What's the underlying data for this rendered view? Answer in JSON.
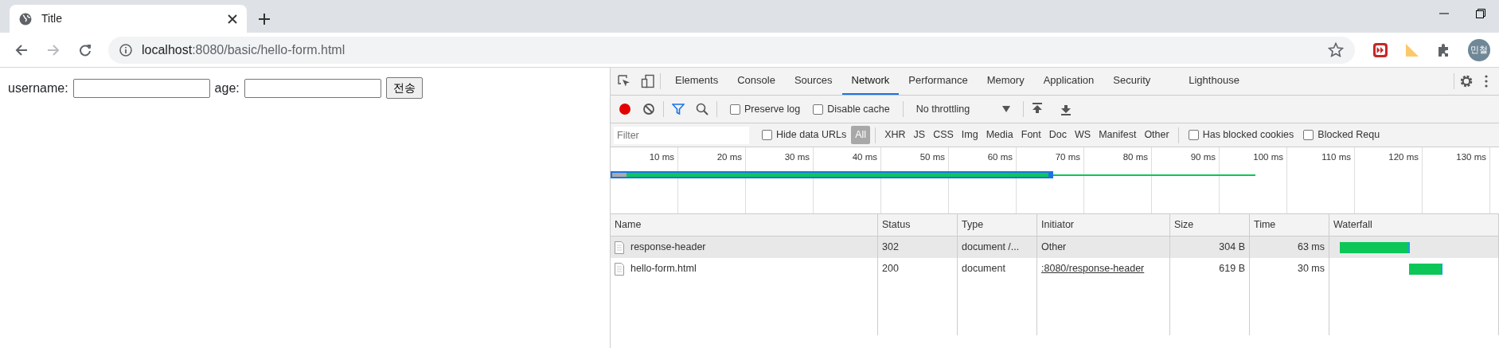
{
  "browser": {
    "tabs": [
      {
        "title": "Title",
        "selected": true
      }
    ],
    "address": {
      "host": "localhost",
      "path": ":8080/basic/hello-form.html"
    },
    "forward_disabled": true,
    "avatar": "민철"
  },
  "page": {
    "fields": [
      {
        "label": "username:"
      },
      {
        "label": "age:"
      }
    ],
    "submit": "전송"
  },
  "devtools": {
    "tabs": [
      {
        "label": "Elements",
        "selected": false
      },
      {
        "label": "Console",
        "selected": false
      },
      {
        "label": "Sources",
        "selected": false
      },
      {
        "label": "Network",
        "selected": true
      },
      {
        "label": "Performance",
        "selected": false
      },
      {
        "label": "Memory",
        "selected": false
      },
      {
        "label": "Application",
        "selected": false
      },
      {
        "label": "Security",
        "selected": false
      },
      {
        "label": "Lighthouse",
        "selected": false
      }
    ],
    "toolbar": {
      "recording": true,
      "checkboxes": [
        {
          "label": "Preserve log",
          "checked": false
        },
        {
          "label": "Disable cache",
          "checked": false
        }
      ],
      "throttling": "No throttling"
    },
    "filter": {
      "placeholder": "Filter",
      "hide_data_urls": {
        "label": "Hide data URLs",
        "checked": false
      },
      "types": [
        {
          "label": "All",
          "selected": true
        },
        {
          "label": "XHR",
          "selected": false
        },
        {
          "label": "JS",
          "selected": false
        },
        {
          "label": "CSS",
          "selected": false
        },
        {
          "label": "Img",
          "selected": false
        },
        {
          "label": "Media",
          "selected": false
        },
        {
          "label": "Font",
          "selected": false
        },
        {
          "label": "Doc",
          "selected": false
        },
        {
          "label": "WS",
          "selected": false
        },
        {
          "label": "Manifest",
          "selected": false
        },
        {
          "label": "Other",
          "selected": false
        }
      ],
      "more": [
        {
          "label": "Has blocked cookies",
          "checked": false
        },
        {
          "label": "Blocked Requ",
          "checked": false
        }
      ]
    },
    "timeline": {
      "ticks": [
        "10 ms",
        "20 ms",
        "30 ms",
        "40 ms",
        "50 ms",
        "60 ms",
        "70 ms",
        "80 ms",
        "90 ms",
        "100 ms",
        "110 ms",
        "120 ms",
        "130 ms"
      ]
    },
    "table": {
      "columns": [
        "Name",
        "Status",
        "Type",
        "Initiator",
        "Size",
        "Time",
        "Waterfall"
      ],
      "rows": [
        {
          "name": "response-header",
          "status": "302",
          "type": "document /...",
          "initiator": "Other",
          "initiator_link": false,
          "size": "304 B",
          "time": "63 ms",
          "selected": true
        },
        {
          "name": "hello-form.html",
          "status": "200",
          "type": "document",
          "initiator": ":8080/response-header",
          "initiator_link": true,
          "size": "619 B",
          "time": "30 ms",
          "selected": false
        }
      ]
    }
  }
}
